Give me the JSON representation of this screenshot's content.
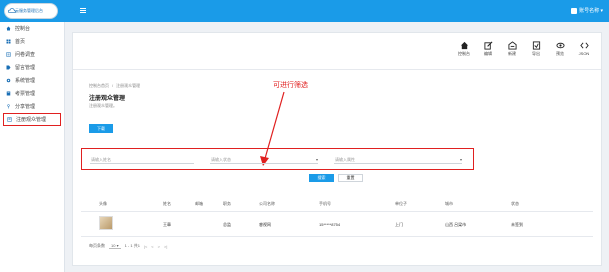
{
  "app": {
    "logo_text": "云服务管理后台"
  },
  "header": {
    "user_name": "账号名称 ▾"
  },
  "sidebar": {
    "items": [
      {
        "label": "控制台",
        "icon": "home-icon"
      },
      {
        "label": "首页",
        "icon": "grid-icon"
      },
      {
        "label": "问卷调查",
        "icon": "document-icon"
      },
      {
        "label": "留言管理",
        "icon": "tag-icon"
      },
      {
        "label": "系统管理",
        "icon": "gear-icon"
      },
      {
        "label": "考票管理",
        "icon": "ticket-icon"
      },
      {
        "label": "分享管理",
        "icon": "share-icon"
      },
      {
        "label": "注册观众管理",
        "icon": "users-icon"
      }
    ]
  },
  "toolbar": {
    "items": [
      {
        "label": "控制台",
        "icon": "home-icon"
      },
      {
        "label": "编辑",
        "icon": "edit-icon"
      },
      {
        "label": "新建",
        "icon": "new-icon"
      },
      {
        "label": "导出",
        "icon": "export-icon"
      },
      {
        "label": "预览",
        "icon": "eye-icon"
      },
      {
        "label": "JSON",
        "icon": "code-icon"
      }
    ]
  },
  "breadcrumb": {
    "home": "控制台首页",
    "separator": "/",
    "current": "注册观众管理"
  },
  "page": {
    "title": "注册观众管理",
    "subtitle": "注册观众管理。",
    "upload_label": "下载"
  },
  "annotation": {
    "text": "可进行筛选"
  },
  "filters": {
    "name_placeholder": "请输入姓名",
    "status_placeholder": "请输入状态",
    "type_placeholder": "请输入属性"
  },
  "actions": {
    "search_label": "搜索",
    "reset_label": "重置"
  },
  "table": {
    "headers": [
      "头像",
      "姓名",
      "邮箱",
      "职务",
      "公司名称",
      "手机号",
      "单位子",
      "城市",
      "状态"
    ],
    "rows": [
      {
        "name": "王章",
        "email": "",
        "position": "总监",
        "company": "睿视网",
        "phone": "15*****8754",
        "unit": "上门",
        "city": "山西 吕梁市",
        "status": "未签到"
      }
    ]
  },
  "pagination": {
    "per_page_label": "每页条数",
    "per_page_value": "10",
    "range": "1 - 1 共1",
    "first": "|<",
    "prev": "<",
    "next": ">",
    "last": ">|"
  },
  "colors": {
    "accent": "#1a9be8",
    "highlight": "#e02020"
  }
}
